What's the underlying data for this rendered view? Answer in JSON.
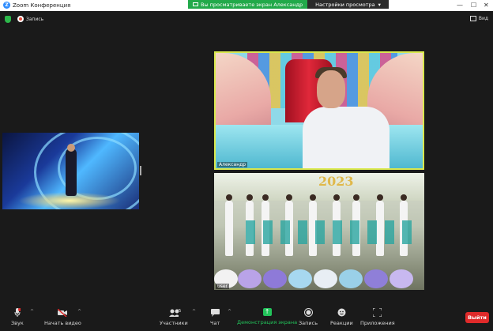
{
  "titlebar": {
    "title": "Zoom Конференция",
    "minimize": "—",
    "maximize": "☐",
    "close": "✕"
  },
  "share_banner": {
    "status": "Вы просматриваете экран Александр",
    "settings": "Настройки просмотра"
  },
  "topbar": {
    "record_label": "Запись",
    "view_label": "Вид"
  },
  "tiles": {
    "main_name": "Александр",
    "room_name": "user",
    "room_sign": "2023"
  },
  "toolbar": {
    "audio": "Звук",
    "video": "Начать видео",
    "participants": "Участники",
    "participants_count": "5",
    "chat": "Чат",
    "share": "Демонстрация экрана",
    "record": "Запись",
    "reactions": "Реакции",
    "apps": "Приложения",
    "leave": "Выйти"
  },
  "colors": {
    "share_green": "#22c35a",
    "leave_red": "#e02a2a",
    "active_speaker": "#d9e84e",
    "zoom_blue": "#2d8cff"
  }
}
